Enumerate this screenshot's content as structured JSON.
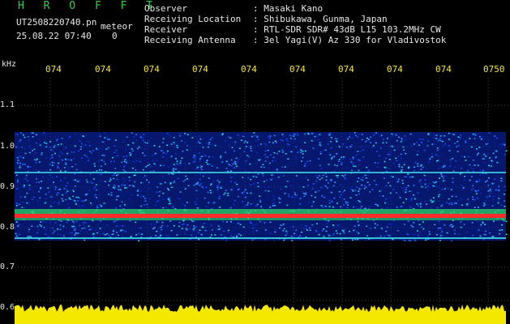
{
  "header": {
    "title": "H R O F F T",
    "filename": "UT2508220740.pn",
    "tag": "meteor",
    "datetime": "25.08.22 07:40",
    "count": "0",
    "fields": [
      {
        "label": "Observer",
        "value": ": Masaki Kano"
      },
      {
        "label": "Receiving Location",
        "value": ": Shibukawa, Gunma, Japan"
      },
      {
        "label": "Receiver",
        "value": ": RTL-SDR SDR# 43dB L15 103.2MHz CW"
      },
      {
        "label": "Receiving Antenna",
        "value": ": 3el Yagi(V) Az 330 for Vladivostok"
      }
    ]
  },
  "axis": {
    "unit": "kHz",
    "x_ticks": [
      "074",
      "074",
      "074",
      "074",
      "074",
      "074",
      "074",
      "074",
      "074",
      "0750"
    ],
    "y_ticks": [
      "1.1",
      "1.0",
      "0.9",
      "0.8",
      "0.7",
      "0.6"
    ]
  },
  "colors": {
    "background": "#000000",
    "time_label": "#f5e24a",
    "signal_band": "#ff2a2a",
    "bottom_bar": "#f4e800",
    "noise_base": "#0a2cc8"
  }
}
